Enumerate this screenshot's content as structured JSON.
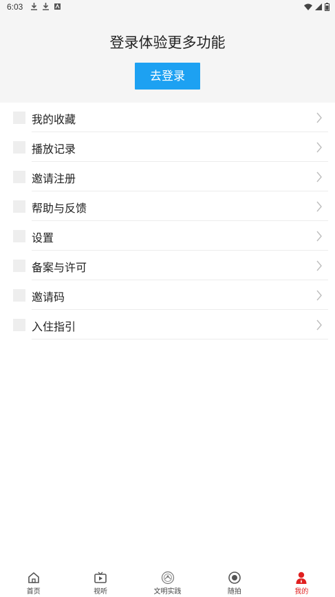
{
  "status_bar": {
    "time": "6:03"
  },
  "header": {
    "title": "登录体验更多功能",
    "login_button": "去登录"
  },
  "menu": {
    "items": [
      {
        "label": "我的收藏"
      },
      {
        "label": "播放记录"
      },
      {
        "label": "邀请注册"
      },
      {
        "label": "帮助与反馈"
      },
      {
        "label": "设置"
      },
      {
        "label": "备案与许可"
      },
      {
        "label": "邀请码"
      },
      {
        "label": "入住指引"
      }
    ]
  },
  "tabbar": {
    "tabs": [
      {
        "label": "首页",
        "icon": "home-icon"
      },
      {
        "label": "视听",
        "icon": "tv-icon"
      },
      {
        "label": "文明实践",
        "icon": "emblem-icon"
      },
      {
        "label": "随拍",
        "icon": "camera-lens-icon"
      },
      {
        "label": "我的",
        "icon": "user-icon"
      }
    ],
    "active_color": "#e02020"
  },
  "colors": {
    "accent": "#1da1f2",
    "header_bg": "#f5f5f5"
  }
}
